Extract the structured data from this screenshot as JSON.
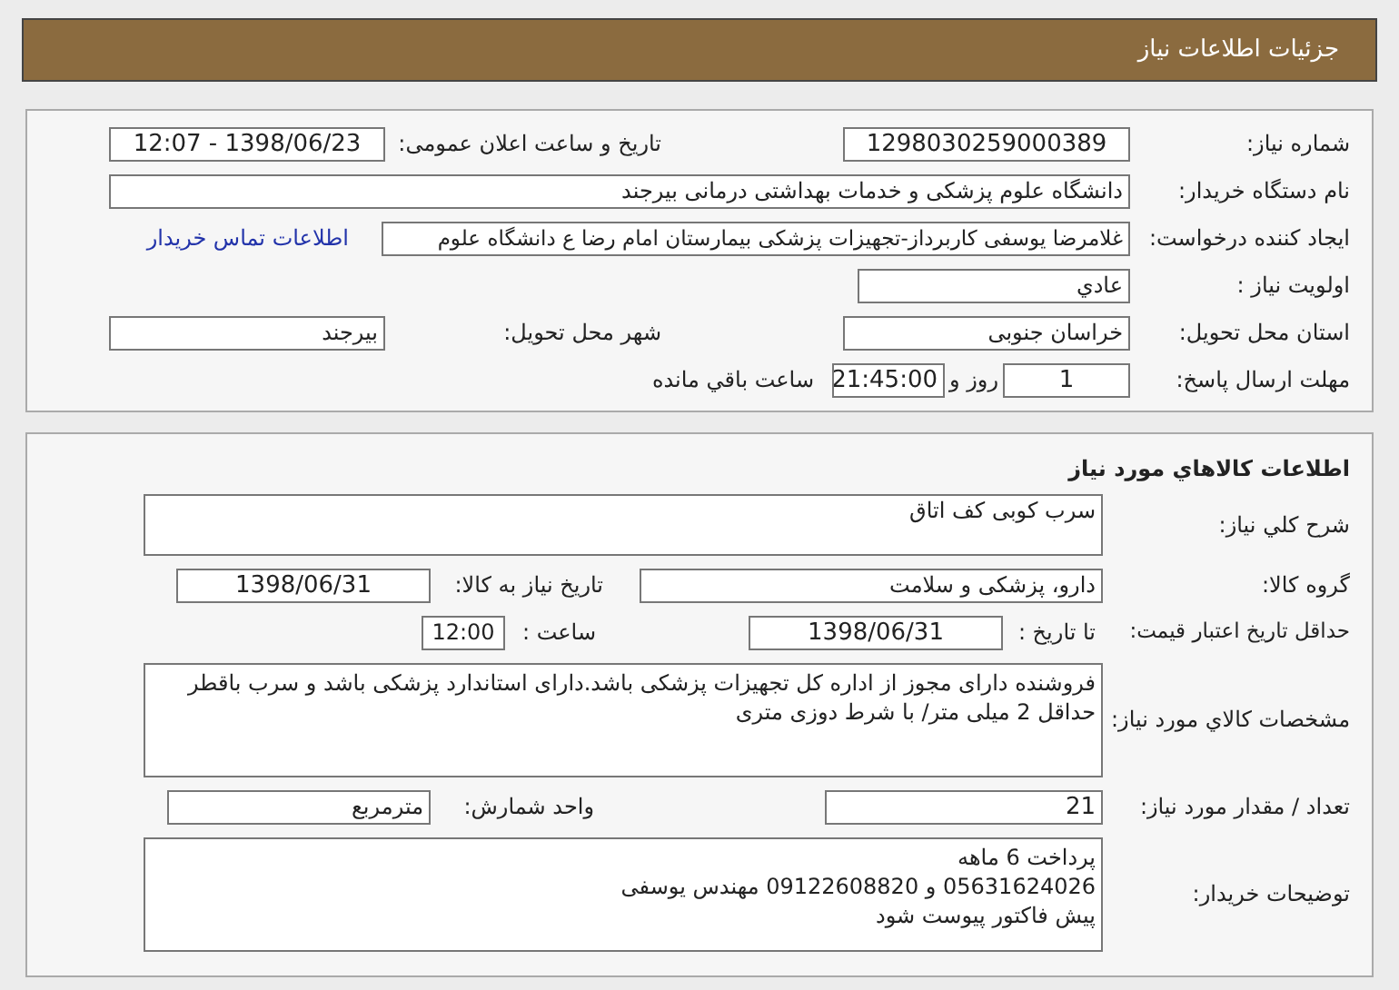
{
  "header": {
    "title": "جزئیات اطلاعات نیاز"
  },
  "need_info": {
    "need_number": {
      "label": "شماره نیاز:",
      "value": "1298030259000389"
    },
    "announce_datetime": {
      "label": "تاریخ و ساعت اعلان عمومی:",
      "value": "1398/06/23 - 12:07"
    },
    "buyer_org": {
      "label": "نام دستگاه خریدار:",
      "value": "دانشگاه علوم پزشکی و خدمات بهداشتی درمانی بیرجند"
    },
    "requester": {
      "label": "ایجاد کننده درخواست:",
      "value": "غلامرضا یوسفی کاربرداز-تجهیزات پزشکی بیمارستان امام رضا ع دانشگاه علوم"
    },
    "buyer_contact_link": "اطلاعات تماس خریدار",
    "priority": {
      "label": "اولویت نیاز :",
      "value": "عادي"
    },
    "delivery_province": {
      "label": "استان محل تحویل:",
      "value": "خراسان جنوبی"
    },
    "delivery_city": {
      "label": "شهر محل تحویل:",
      "value": "بیرجند"
    },
    "response_deadline": {
      "label": "مهلت ارسال پاسخ:",
      "days": "1",
      "days_suffix": "روز و",
      "time": "21:45:00",
      "time_suffix": "ساعت باقي مانده"
    }
  },
  "goods": {
    "title": "اطلاعات کالاهاي مورد نیاز",
    "description": {
      "label": "شرح کلي نیاز:",
      "value": "سرب کوبی کف اتاق"
    },
    "goods_group": {
      "label": "گروه کالا:",
      "value": "دارو، پزشکی و سلامت"
    },
    "need_date": {
      "label": "تاریخ نیاز به کالا:",
      "value": "1398/06/31"
    },
    "price_validity": {
      "label": "حداقل تاریخ اعتبار قیمت:",
      "date_label": "تا تاریخ :",
      "date": "1398/06/31",
      "time_label": "ساعت :",
      "time": "12:00"
    },
    "specs": {
      "label": "مشخصات کالاي مورد نیاز:",
      "value": "فروشنده دارای مجوز از اداره کل تجهیزات پزشکی باشد.دارای استاندارد پزشکی باشد و سرب باقطر حداقل 2 میلی متر/ با شرط دوزی متری"
    },
    "quantity": {
      "label": "تعداد / مقدار مورد نیاز:",
      "value": "21"
    },
    "unit": {
      "label": "واحد شمارش:",
      "value": "مترمربع"
    },
    "buyer_notes": {
      "label": "توضیحات خریدار:",
      "lines": [
        "پرداخت 6 ماهه",
        "05631624026 و 09122608820 مهندس یوسفی",
        "پیش فاکتور پیوست شود"
      ]
    }
  }
}
